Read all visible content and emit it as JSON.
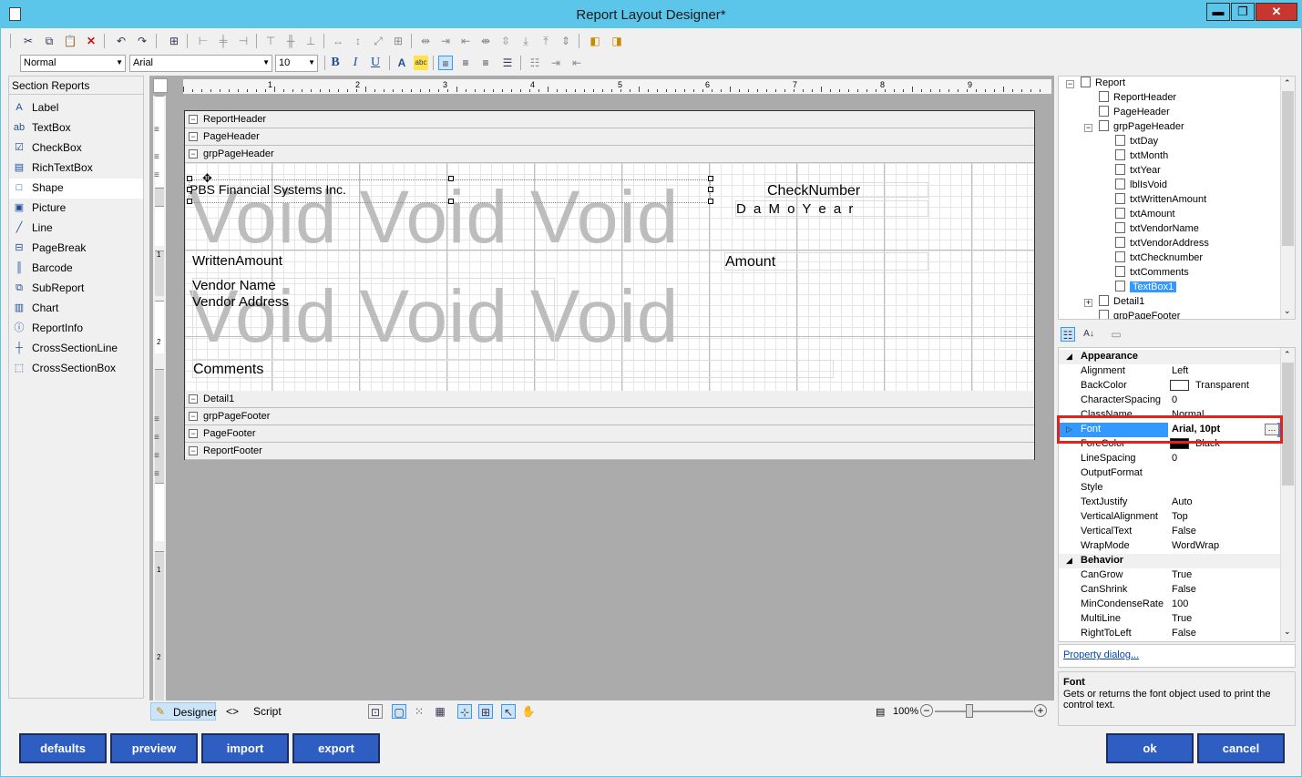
{
  "window": {
    "title": "Report Layout Designer*",
    "minimize": "▬",
    "maximize": "❐",
    "close": "✕"
  },
  "toolbar2": {
    "style": "Normal",
    "font": "Arial",
    "size": "10"
  },
  "toolbox": {
    "header": "Section Reports",
    "items": [
      {
        "label": "Label",
        "icon": "label-icon",
        "glyph": "A"
      },
      {
        "label": "TextBox",
        "icon": "textbox-icon",
        "glyph": "ab"
      },
      {
        "label": "CheckBox",
        "icon": "checkbox-icon",
        "glyph": "☑"
      },
      {
        "label": "RichTextBox",
        "icon": "richtextbox-icon",
        "glyph": "▤"
      },
      {
        "label": "Shape",
        "icon": "shape-icon",
        "glyph": "□"
      },
      {
        "label": "Picture",
        "icon": "picture-icon",
        "glyph": "▣"
      },
      {
        "label": "Line",
        "icon": "line-icon",
        "glyph": "╱"
      },
      {
        "label": "PageBreak",
        "icon": "pagebreak-icon",
        "glyph": "⊟"
      },
      {
        "label": "Barcode",
        "icon": "barcode-icon",
        "glyph": "║"
      },
      {
        "label": "SubReport",
        "icon": "subreport-icon",
        "glyph": "⧉"
      },
      {
        "label": "Chart",
        "icon": "chart-icon",
        "glyph": "▥"
      },
      {
        "label": "ReportInfo",
        "icon": "reportinfo-icon",
        "glyph": "ⓘ"
      },
      {
        "label": "CrossSectionLine",
        "icon": "crosssectionline-icon",
        "glyph": "┼"
      },
      {
        "label": "CrossSectionBox",
        "icon": "crosssectionbox-icon",
        "glyph": "⬚"
      }
    ]
  },
  "ruler": {
    "marks": [
      "1",
      "2",
      "3",
      "4",
      "5",
      "6",
      "7",
      "8",
      "9"
    ],
    "left_marks": [
      "1",
      "2",
      "1",
      "2"
    ]
  },
  "report": {
    "bands_top": [
      "ReportHeader",
      "PageHeader",
      "grpPageHeader"
    ],
    "bands_bottom": [
      "Detail1",
      "grpPageFooter",
      "PageFooter",
      "ReportFooter"
    ],
    "fields": {
      "company": "PBS Financial Systems Inc.",
      "check_number": "CheckNumber",
      "date": "D a M o Y e a r",
      "written_amount": "WrittenAmount",
      "amount": "Amount",
      "vendor_name": "Vendor Name",
      "vendor_address": "Vendor Address",
      "comments": "Comments"
    },
    "watermark": "Void Void Void"
  },
  "bottom": {
    "designer": "Designer",
    "script": "Script",
    "zoom": "100%"
  },
  "tree": {
    "root": "Report",
    "nodes": [
      "ReportHeader",
      "PageHeader",
      "grpPageHeader",
      "txtDay",
      "txtMonth",
      "txtYear",
      "lblIsVoid",
      "txtWrittenAmount",
      "txtAmount",
      "txtVendorName",
      "txtVendorAddress",
      "txtChecknumber",
      "txtComments",
      "TextBox1",
      "Detail1",
      "grpPageFooter"
    ]
  },
  "properties": {
    "appearance_label": "Appearance",
    "behavior_label": "Behavior",
    "appearance": [
      {
        "name": "Alignment",
        "value": "Left"
      },
      {
        "name": "BackColor",
        "value": "Transparent"
      },
      {
        "name": "CharacterSpacing",
        "value": "0"
      },
      {
        "name": "ClassName",
        "value": "Normal"
      },
      {
        "name": "Font",
        "value": "Arial, 10pt"
      },
      {
        "name": "ForeColor",
        "value": "Black"
      },
      {
        "name": "LineSpacing",
        "value": "0"
      },
      {
        "name": "OutputFormat",
        "value": ""
      },
      {
        "name": "Style",
        "value": ""
      },
      {
        "name": "TextJustify",
        "value": "Auto"
      },
      {
        "name": "VerticalAlignment",
        "value": "Top"
      },
      {
        "name": "VerticalText",
        "value": "False"
      },
      {
        "name": "WrapMode",
        "value": "WordWrap"
      }
    ],
    "behavior": [
      {
        "name": "CanGrow",
        "value": "True"
      },
      {
        "name": "CanShrink",
        "value": "False"
      },
      {
        "name": "MinCondenseRate",
        "value": "100"
      },
      {
        "name": "MultiLine",
        "value": "True"
      },
      {
        "name": "RightToLeft",
        "value": "False"
      }
    ],
    "link": "Property dialog...",
    "desc_title": "Font",
    "desc_text": "Gets or returns the font object used to print the control text."
  },
  "buttons": {
    "defaults": "defaults",
    "preview": "preview",
    "import": "import",
    "export": "export",
    "ok": "ok",
    "cancel": "cancel"
  },
  "colors": {
    "titlebar": "#5bc6ea",
    "button": "#2f5ec3",
    "highlight": "#e2231a",
    "selection": "#3399ff"
  }
}
